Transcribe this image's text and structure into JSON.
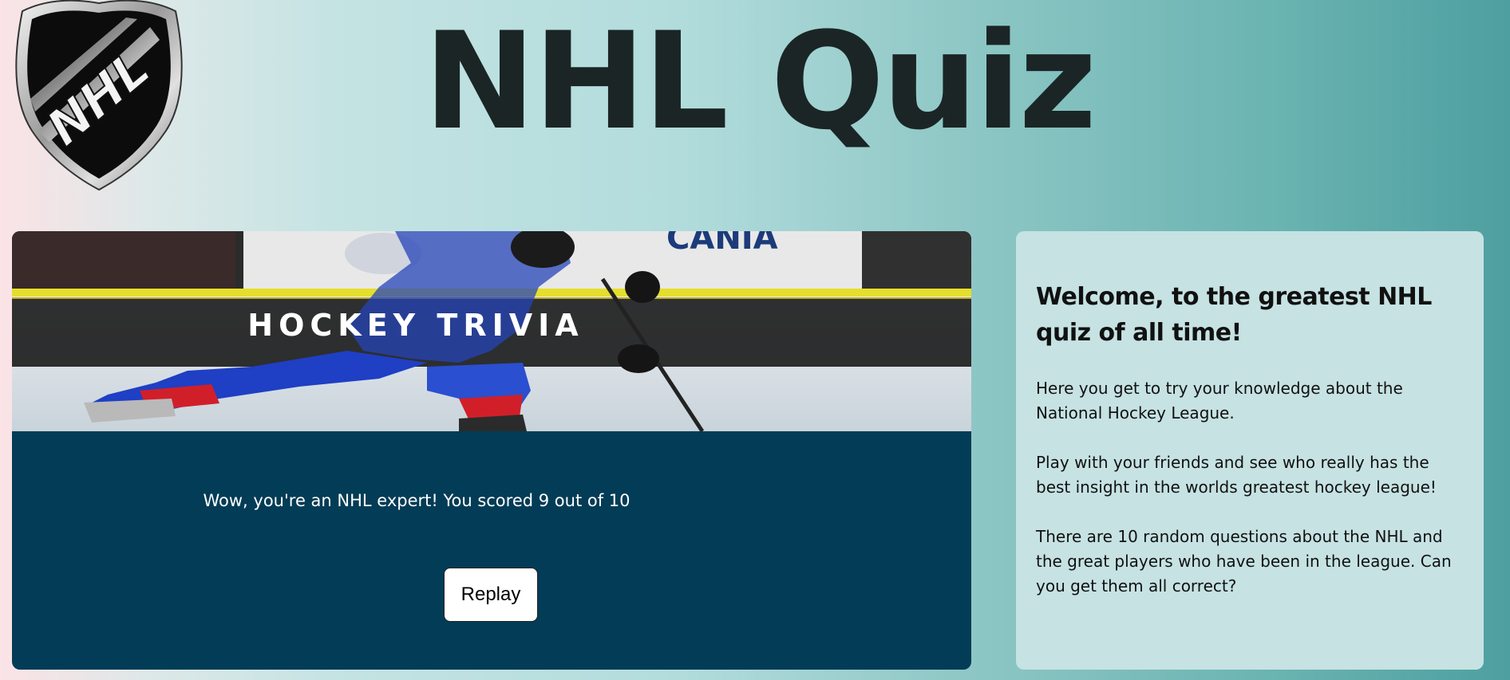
{
  "logo": {
    "icon": "nhl-shield-logo",
    "text": "NHL"
  },
  "header": {
    "title": "NHL Quiz"
  },
  "quiz": {
    "banner_title": "HOCKEY TRIVIA",
    "banner_image": "hockey-player-skating-photo",
    "result_text": "Wow, you're an NHL expert! You scored 9 out of 10",
    "replay_label": "Replay"
  },
  "info": {
    "heading": "Welcome, to the greatest NHL quiz of all time!",
    "paragraphs": [
      "Here you get to try your knowledge about the National Hockey League.",
      "Play with your friends and see who really has the best insight in the worlds greatest hockey league!",
      "There are 10 random questions about the NHL and the great players who have been in the league. Can you get them all correct?"
    ]
  },
  "colors": {
    "quiz_card_bg": "#033c56",
    "info_card_bg": "#c6e2e3",
    "title_color": "#1b2526"
  }
}
